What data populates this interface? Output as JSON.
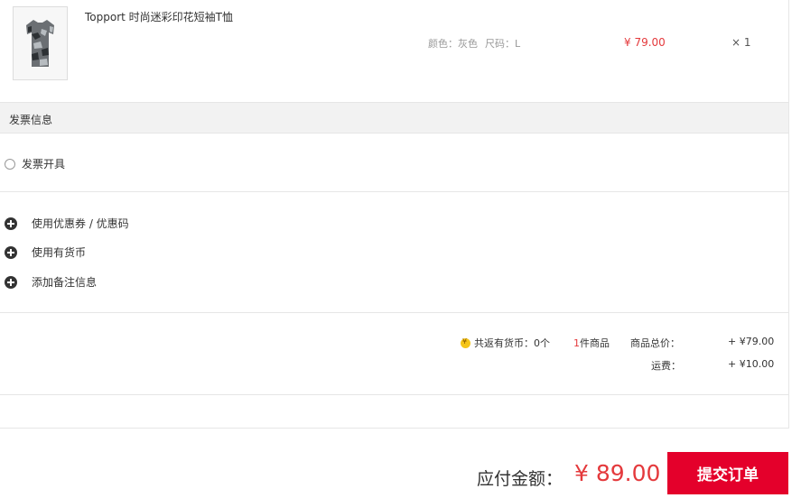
{
  "product": {
    "name": "Topport 时尚迷彩印花短袖T恤",
    "color": "颜色：灰色",
    "size": "尺码：L",
    "price": "¥ 79.00",
    "quantity": "× 1",
    "image_icon": "camouflage-tshirt-icon"
  },
  "invoice": {
    "section_title": "发票信息",
    "option_label": "发票开具"
  },
  "actions": [
    {
      "label": "使用优惠券 / 优惠码",
      "icon": "plus-circle-icon"
    },
    {
      "label": "使用有货币",
      "icon": "plus-circle-icon"
    },
    {
      "label": "添加备注信息",
      "icon": "plus-circle-icon"
    }
  ],
  "summary": {
    "coin_text": "共返有货币：0个",
    "item_count": "1",
    "item_count_suffix": "件商品",
    "total_label": "商品总价：",
    "total_value": "+ ¥79.00",
    "shipping_label": "运费：",
    "shipping_value": "+ ¥10.00"
  },
  "footer": {
    "payable_label": "应付金额：",
    "payable_value": "¥ 89.00",
    "submit_label": "提交订单"
  },
  "colors": {
    "accent_red": "#e4393c",
    "submit_bg": "#e4002b",
    "section_bg": "#f2f2f2"
  }
}
